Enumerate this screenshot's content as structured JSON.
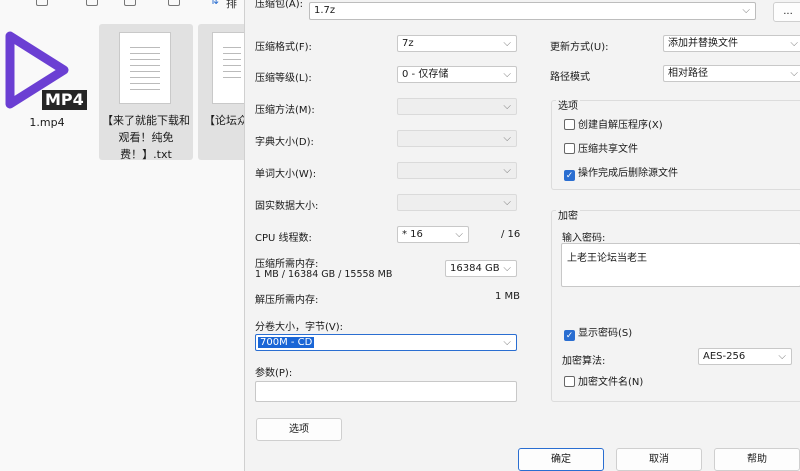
{
  "explorer": {
    "toolbar_partial": "排",
    "files": [
      {
        "name": "1.mp4",
        "badge": "MP4"
      },
      {
        "name": "【来了就能下载和观看！纯免费！】.txt"
      },
      {
        "name": "【论坛众"
      }
    ]
  },
  "dialog": {
    "archive_label": "压缩包(A):",
    "archive_value": "1.7z",
    "browse_label": "...",
    "left": {
      "format_label": "压缩格式(F):",
      "format_value": "7z",
      "level_label": "压缩等级(L):",
      "level_value": "0 - 仅存储",
      "method_label": "压缩方法(M):",
      "dict_label": "字典大小(D):",
      "word_label": "单词大小(W):",
      "solid_label": "固实数据大小:",
      "cpu_label": "CPU 线程数:",
      "cpu_value": "* 16",
      "cpu_max": "/ 16",
      "mem_label": "压缩所需内存:",
      "mem_detail": "1 MB / 16384 GB / 15558 MB",
      "mem_value": "16384 GB",
      "decomp_label": "解压所需内存:",
      "decomp_value": "1 MB",
      "split_label": "分卷大小，字节(V):",
      "split_value": "700M - CD",
      "params_label": "参数(P):",
      "params_value": "",
      "options_button": "选项"
    },
    "right": {
      "update_label": "更新方式(U):",
      "update_value": "添加并替换文件",
      "path_label": "路径模式",
      "path_value": "相对路径",
      "options_group": "选项",
      "sfx_label": "创建自解压程序(X)",
      "sfx_checked": false,
      "shared_label": "压缩共享文件",
      "shared_checked": false,
      "delete_label": "操作完成后删除源文件",
      "delete_checked": true,
      "encrypt_group": "加密",
      "password_label": "输入密码:",
      "password_value": "上老王论坛当老王",
      "show_pw_label": "显示密码(S)",
      "show_pw_checked": true,
      "algo_label": "加密算法:",
      "algo_value": "AES-256",
      "encnames_label": "加密文件名(N)",
      "encnames_checked": false
    },
    "buttons": {
      "ok": "确定",
      "cancel": "取消",
      "help": "帮助"
    }
  },
  "colors": {
    "accent": "#2a6ed1",
    "selection": "#1a66d6",
    "play_icon": "#6b3fd3"
  }
}
